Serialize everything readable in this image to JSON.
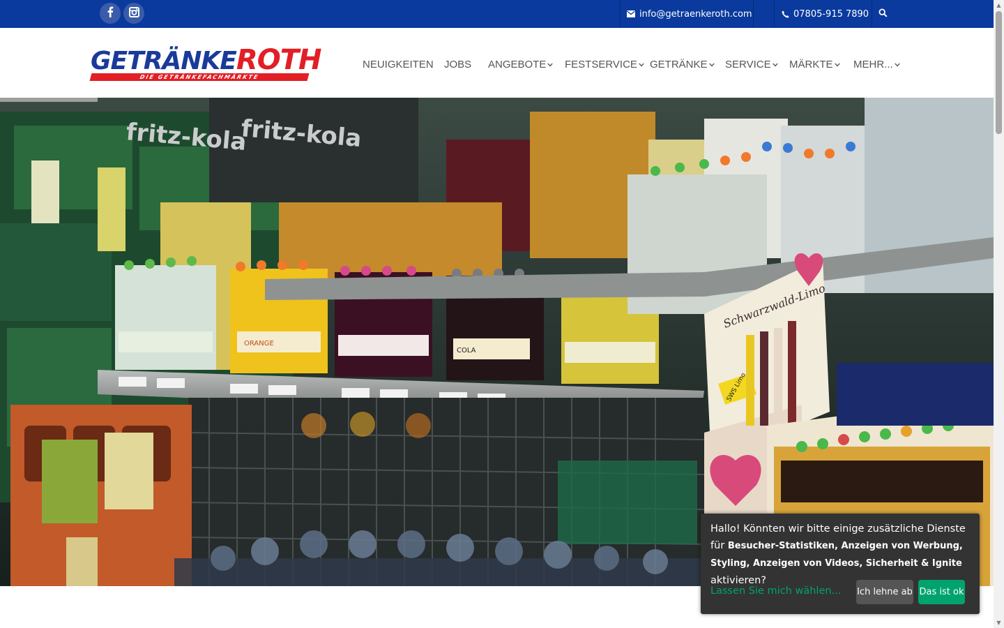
{
  "topbar": {
    "social": {
      "facebook_icon": "facebook-icon",
      "instagram_icon": "instagram-icon"
    },
    "email": "info@getraenkeroth.com",
    "phone": "07805-915 7890",
    "search_icon": "search-icon",
    "color": "#0a3a9e"
  },
  "logo": {
    "part1": "GETRÄNKE",
    "part2": "ROTH",
    "tagline": "DIE GETRÄNKEFACHMÄRKTE"
  },
  "nav": {
    "items": [
      {
        "label": "NEUIGKEITEN",
        "dropdown": false
      },
      {
        "label": "JOBS",
        "dropdown": false
      },
      {
        "label": "ANGEBOTE",
        "dropdown": true
      },
      {
        "label": "FESTSERVICE",
        "dropdown": true
      },
      {
        "label": "GETRÄNKE",
        "dropdown": true
      },
      {
        "label": "SERVICE",
        "dropdown": true
      },
      {
        "label": "MÄRKTE",
        "dropdown": true
      },
      {
        "label": "MEHR...",
        "dropdown": true
      }
    ]
  },
  "hero": {
    "image": "photo of beverage shelves with bottled lemonades, juices and mineral water in crates",
    "crate_label": "fritz-kola",
    "sign_text": "Schwarzwald-Limo",
    "price_tag": "SWS Limo",
    "bottle_labels": [
      "ORANGE",
      "COLA"
    ]
  },
  "cookie": {
    "msg_start": "Hallo! Könnten wir bitte einige zusätzliche Dienste für",
    "services": "Besucher-Statistiken, Anzeigen von Werbung, Styling, Anzeigen von Videos, Sicherheit & Ignite",
    "msg_end": "aktivieren?",
    "choose": "Lassen Sie mich wählen...",
    "decline": "Ich lehne ab",
    "accept": "Das ist ok",
    "accent": "#00a36e"
  }
}
